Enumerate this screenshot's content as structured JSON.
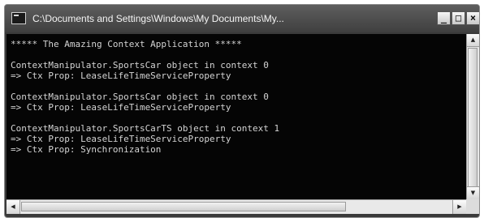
{
  "window": {
    "title": "C:\\Documents and Settings\\Windows\\My Documents\\My..."
  },
  "title_buttons": {
    "minimize": "_",
    "maximize": "□",
    "close": "×"
  },
  "console": {
    "lines": [
      "***** The Amazing Context Application *****",
      "",
      "ContextManipulator.SportsCar object in context 0",
      "=> Ctx Prop: LeaseLifeTimeServiceProperty",
      "",
      "ContextManipulator.SportsCar object in context 0",
      "=> Ctx Prop: LeaseLifeTimeServiceProperty",
      "",
      "ContextManipulator.SportsCarTS object in context 1",
      "=> Ctx Prop: LeaseLifeTimeServiceProperty",
      "=> Ctx Prop: Synchronization"
    ]
  },
  "scrollbars": {
    "up_arrow": "▲",
    "down_arrow": "▼",
    "left_arrow": "◀",
    "right_arrow": "▶"
  },
  "colors": {
    "console_background": "#050505",
    "console_text": "#d4d4d4",
    "titlebar": "#4a4a4a"
  }
}
